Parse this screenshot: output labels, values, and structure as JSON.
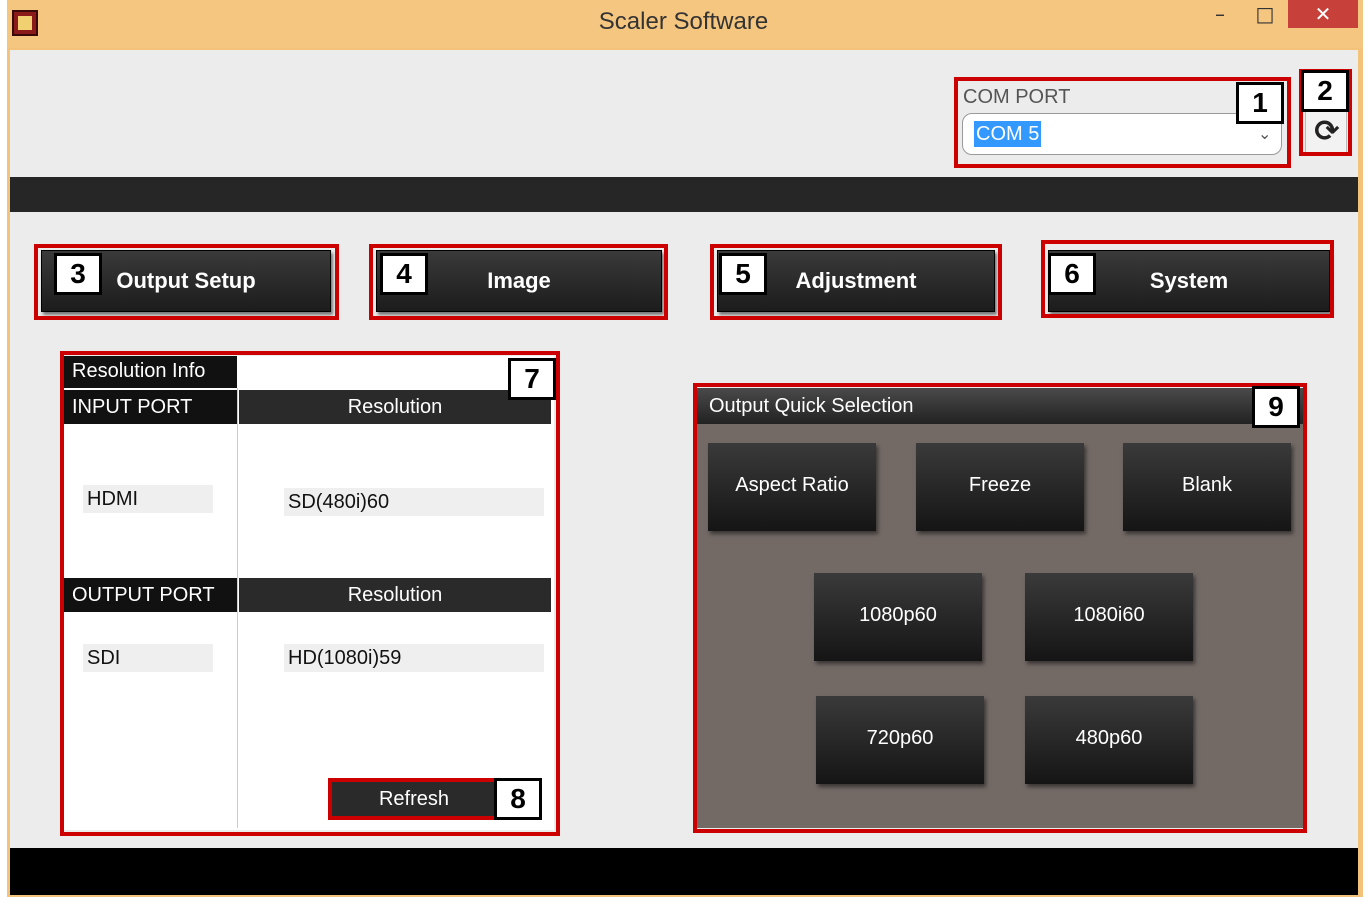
{
  "window": {
    "title": "Scaler Software",
    "minimize": "–",
    "maximize": "□",
    "close": "✕"
  },
  "com_port": {
    "label": "COM PORT",
    "selected": "COM 5",
    "chevron": "⌄",
    "refresh_icon": "refresh-icon"
  },
  "nav": {
    "output_setup": "Output Setup",
    "image": "Image",
    "adjustment": "Adjustment",
    "system": "System"
  },
  "resolution_info": {
    "title": "Resolution Info",
    "input_port_header": "INPUT PORT",
    "input_resolution_header": "Resolution",
    "input_port": "HDMI",
    "input_resolution": "SD(480i)60",
    "output_port_header": "OUTPUT PORT",
    "output_resolution_header": "Resolution",
    "output_port": "SDI",
    "output_resolution": "HD(1080i)59",
    "refresh_label": "Refresh"
  },
  "quick_selection": {
    "title": "Output Quick Selection",
    "buttons": [
      "Aspect Ratio",
      "Freeze",
      "Blank",
      "1080p60",
      "1080i60",
      "720p60",
      "480p60"
    ]
  },
  "callouts": [
    "1",
    "2",
    "3",
    "4",
    "5",
    "6",
    "7",
    "8",
    "9"
  ],
  "colors": {
    "accent_red": "#cc0000",
    "title_bar": "#f5c680",
    "selection_blue": "#3399ff",
    "panel_brown": "#736a66"
  }
}
